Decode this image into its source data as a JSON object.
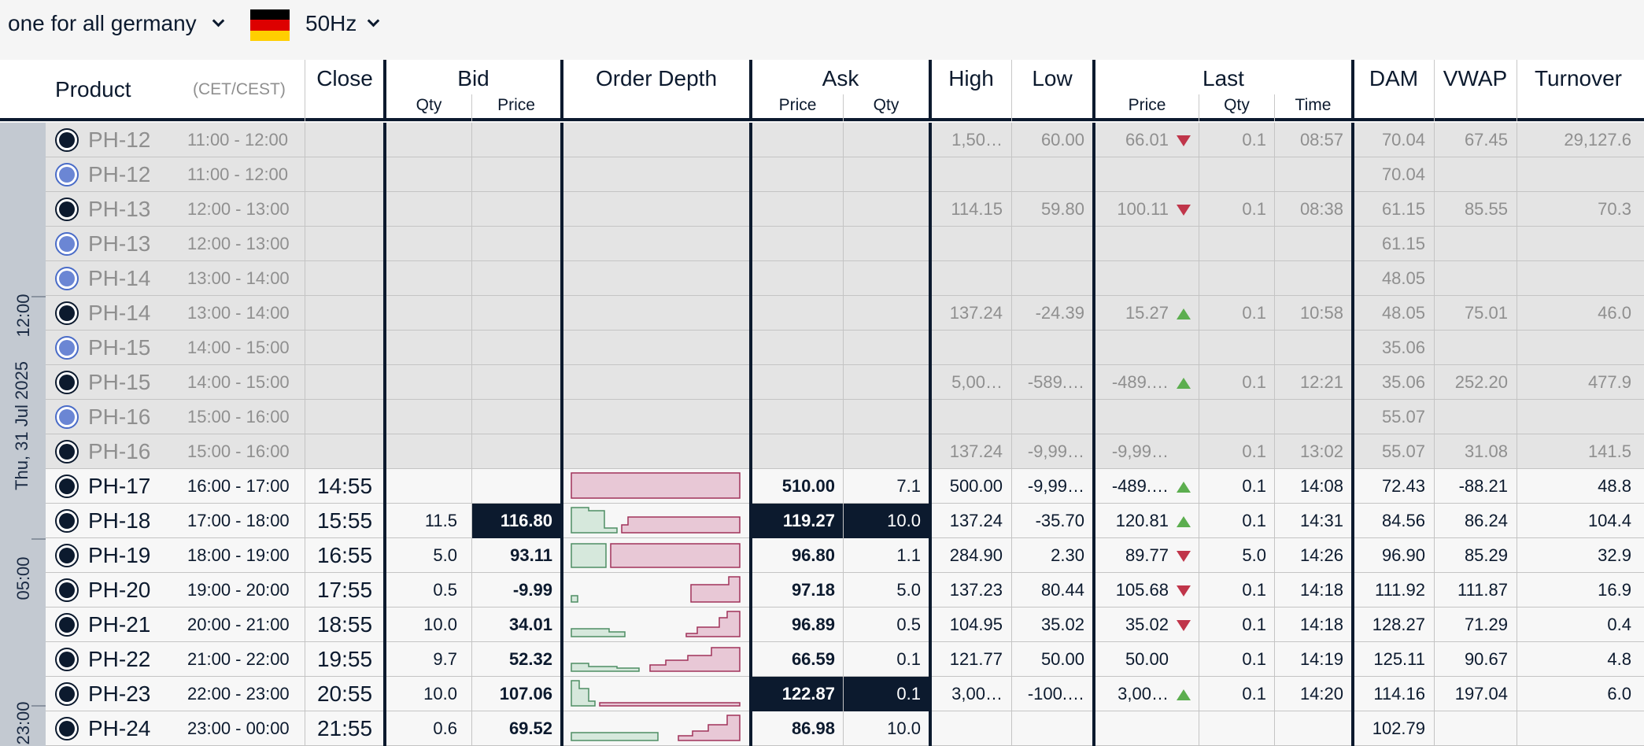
{
  "topbar": {
    "market": "one for all germany",
    "frequency": "50Hz",
    "flag_colors": [
      "#000000",
      "#dd0000",
      "#ffce00"
    ]
  },
  "header": {
    "product": "Product",
    "timezone": "(CET/CEST)",
    "close": "Close",
    "bid": "Bid",
    "bid_qty": "Qty",
    "bid_price": "Price",
    "order_depth": "Order Depth",
    "ask": "Ask",
    "ask_price": "Price",
    "ask_qty": "Qty",
    "high": "High",
    "low": "Low",
    "last": "Last",
    "last_price": "Price",
    "last_qty": "Qty",
    "last_time": "Time",
    "dam": "DAM",
    "vwap": "VWAP",
    "turnover": "Turnover"
  },
  "day": {
    "label": "Thu, 31 Jul 2025",
    "tick_12": "12:00",
    "tick_05": "05:00",
    "tick_23": "23:00"
  },
  "colors": {
    "navy": "#0c1a2e",
    "bid_depth": "#d6e8dc",
    "ask_depth": "#e8c8d6",
    "up": "#5cae4f",
    "down": "#c0354a"
  },
  "rows": [
    {
      "state": "past",
      "radio": "dark",
      "product": "PH-12",
      "period": "11:00 - 12:00",
      "close": "",
      "bid_qty": "",
      "bid_price": "",
      "depth": "none",
      "ask_price": "",
      "ask_qty": "",
      "high": "1,50…",
      "low": "60.00",
      "last_price": "66.01",
      "trend": "down",
      "last_qty": "0.1",
      "last_time": "08:57",
      "dam": "70.04",
      "vwap": "67.45",
      "turnover": "29,127.6"
    },
    {
      "state": "past",
      "radio": "blue",
      "product": "PH-12",
      "period": "11:00 - 12:00",
      "close": "",
      "bid_qty": "",
      "bid_price": "",
      "depth": "none",
      "ask_price": "",
      "ask_qty": "",
      "high": "",
      "low": "",
      "last_price": "",
      "trend": "",
      "last_qty": "",
      "last_time": "",
      "dam": "70.04",
      "vwap": "",
      "turnover": ""
    },
    {
      "state": "past",
      "radio": "dark",
      "product": "PH-13",
      "period": "12:00 - 13:00",
      "close": "",
      "bid_qty": "",
      "bid_price": "",
      "depth": "none",
      "ask_price": "",
      "ask_qty": "",
      "high": "114.15",
      "low": "59.80",
      "last_price": "100.11",
      "trend": "down",
      "last_qty": "0.1",
      "last_time": "08:38",
      "dam": "61.15",
      "vwap": "85.55",
      "turnover": "70.3"
    },
    {
      "state": "past",
      "radio": "blue",
      "product": "PH-13",
      "period": "12:00 - 13:00",
      "close": "",
      "bid_qty": "",
      "bid_price": "",
      "depth": "none",
      "ask_price": "",
      "ask_qty": "",
      "high": "",
      "low": "",
      "last_price": "",
      "trend": "",
      "last_qty": "",
      "last_time": "",
      "dam": "61.15",
      "vwap": "",
      "turnover": ""
    },
    {
      "state": "past",
      "radio": "blue",
      "product": "PH-14",
      "period": "13:00 - 14:00",
      "close": "",
      "bid_qty": "",
      "bid_price": "",
      "depth": "none",
      "ask_price": "",
      "ask_qty": "",
      "high": "",
      "low": "",
      "last_price": "",
      "trend": "",
      "last_qty": "",
      "last_time": "",
      "dam": "48.05",
      "vwap": "",
      "turnover": ""
    },
    {
      "state": "past",
      "radio": "dark",
      "product": "PH-14",
      "period": "13:00 - 14:00",
      "close": "",
      "bid_qty": "",
      "bid_price": "",
      "depth": "none",
      "ask_price": "",
      "ask_qty": "",
      "high": "137.24",
      "low": "-24.39",
      "last_price": "15.27",
      "trend": "up",
      "last_qty": "0.1",
      "last_time": "10:58",
      "dam": "48.05",
      "vwap": "75.01",
      "turnover": "46.0"
    },
    {
      "state": "past",
      "radio": "blue",
      "product": "PH-15",
      "period": "14:00 - 15:00",
      "close": "",
      "bid_qty": "",
      "bid_price": "",
      "depth": "none",
      "ask_price": "",
      "ask_qty": "",
      "high": "",
      "low": "",
      "last_price": "",
      "trend": "",
      "last_qty": "",
      "last_time": "",
      "dam": "35.06",
      "vwap": "",
      "turnover": ""
    },
    {
      "state": "past",
      "radio": "dark",
      "product": "PH-15",
      "period": "14:00 - 15:00",
      "close": "",
      "bid_qty": "",
      "bid_price": "",
      "depth": "none",
      "ask_price": "",
      "ask_qty": "",
      "high": "5,00…",
      "low": "-589.…",
      "last_price": "-489.…",
      "trend": "up",
      "last_qty": "0.1",
      "last_time": "12:21",
      "dam": "35.06",
      "vwap": "252.20",
      "turnover": "477.9"
    },
    {
      "state": "past",
      "radio": "blue",
      "product": "PH-16",
      "period": "15:00 - 16:00",
      "close": "",
      "bid_qty": "",
      "bid_price": "",
      "depth": "none",
      "ask_price": "",
      "ask_qty": "",
      "high": "",
      "low": "",
      "last_price": "",
      "trend": "",
      "last_qty": "",
      "last_time": "",
      "dam": "55.07",
      "vwap": "",
      "turnover": ""
    },
    {
      "state": "past",
      "radio": "dark",
      "product": "PH-16",
      "period": "15:00 - 16:00",
      "close": "",
      "bid_qty": "",
      "bid_price": "",
      "depth": "none",
      "ask_price": "",
      "ask_qty": "",
      "high": "137.24",
      "low": "-9,99…",
      "last_price": "-9,99…",
      "trend": "",
      "last_qty": "0.1",
      "last_time": "13:02",
      "dam": "55.07",
      "vwap": "31.08",
      "turnover": "141.5"
    },
    {
      "state": "live",
      "radio": "dark",
      "product": "PH-17",
      "period": "16:00 - 17:00",
      "close": "14:55",
      "bid_qty": "",
      "bid_price": "",
      "depth": "ask-only",
      "ask_price": "510.00",
      "ask_qty": "7.1",
      "ask_hl": false,
      "bid_hl": false,
      "high": "500.00",
      "low": "-9,99…",
      "last_price": "-489.…",
      "trend": "up",
      "last_qty": "0.1",
      "last_time": "14:08",
      "dam": "72.43",
      "vwap": "-88.21",
      "turnover": "48.8"
    },
    {
      "state": "live",
      "radio": "dark",
      "product": "PH-18",
      "period": "17:00 - 18:00",
      "close": "15:55",
      "bid_qty": "11.5",
      "bid_price": "116.80",
      "depth": "d18",
      "ask_price": "119.27",
      "ask_qty": "10.0",
      "ask_hl": true,
      "bid_hl": true,
      "high": "137.24",
      "low": "-35.70",
      "last_price": "120.81",
      "trend": "up",
      "last_qty": "0.1",
      "last_time": "14:31",
      "dam": "84.56",
      "vwap": "86.24",
      "turnover": "104.4"
    },
    {
      "state": "live",
      "radio": "dark",
      "product": "PH-19",
      "period": "18:00 - 19:00",
      "close": "16:55",
      "bid_qty": "5.0",
      "bid_price": "93.11",
      "depth": "d19",
      "ask_price": "96.80",
      "ask_qty": "1.1",
      "ask_hl": false,
      "bid_hl": false,
      "high": "284.90",
      "low": "2.30",
      "last_price": "89.77",
      "trend": "down",
      "last_qty": "5.0",
      "last_time": "14:26",
      "dam": "96.90",
      "vwap": "85.29",
      "turnover": "32.9"
    },
    {
      "state": "live",
      "radio": "dark",
      "product": "PH-20",
      "period": "19:00 - 20:00",
      "close": "17:55",
      "bid_qty": "0.5",
      "bid_price": "-9.99",
      "depth": "d20",
      "ask_price": "97.18",
      "ask_qty": "5.0",
      "ask_hl": false,
      "bid_hl": false,
      "high": "137.23",
      "low": "80.44",
      "last_price": "105.68",
      "trend": "down",
      "last_qty": "0.1",
      "last_time": "14:18",
      "dam": "111.92",
      "vwap": "111.87",
      "turnover": "16.9"
    },
    {
      "state": "live",
      "radio": "dark",
      "product": "PH-21",
      "period": "20:00 - 21:00",
      "close": "18:55",
      "bid_qty": "10.0",
      "bid_price": "34.01",
      "depth": "d21",
      "ask_price": "96.89",
      "ask_qty": "0.5",
      "ask_hl": false,
      "bid_hl": false,
      "high": "104.95",
      "low": "35.02",
      "last_price": "35.02",
      "trend": "down",
      "last_qty": "0.1",
      "last_time": "14:18",
      "dam": "128.27",
      "vwap": "71.29",
      "turnover": "0.4"
    },
    {
      "state": "live",
      "radio": "dark",
      "product": "PH-22",
      "period": "21:00 - 22:00",
      "close": "19:55",
      "bid_qty": "9.7",
      "bid_price": "52.32",
      "depth": "d22",
      "ask_price": "66.59",
      "ask_qty": "0.1",
      "ask_hl": false,
      "bid_hl": false,
      "high": "121.77",
      "low": "50.00",
      "last_price": "50.00",
      "trend": "",
      "last_qty": "0.1",
      "last_time": "14:19",
      "dam": "125.11",
      "vwap": "90.67",
      "turnover": "4.8"
    },
    {
      "state": "live",
      "radio": "dark",
      "product": "PH-23",
      "period": "22:00 - 23:00",
      "close": "20:55",
      "bid_qty": "10.0",
      "bid_price": "107.06",
      "depth": "d23",
      "ask_price": "122.87",
      "ask_qty": "0.1",
      "ask_hl": true,
      "bid_hl": false,
      "high": "3,00…",
      "low": "-100.…",
      "last_price": "3,00…",
      "trend": "up",
      "last_qty": "0.1",
      "last_time": "14:20",
      "dam": "114.16",
      "vwap": "197.04",
      "turnover": "6.0"
    },
    {
      "state": "live",
      "radio": "dark",
      "product": "PH-24",
      "period": "23:00 - 00:00",
      "close": "21:55",
      "bid_qty": "0.6",
      "bid_price": "69.52",
      "depth": "d24",
      "ask_price": "86.98",
      "ask_qty": "10.0",
      "ask_hl": false,
      "bid_hl": false,
      "high": "",
      "low": "",
      "last_price": "",
      "trend": "",
      "last_qty": "",
      "last_time": "",
      "dam": "102.79",
      "vwap": "",
      "turnover": ""
    }
  ]
}
